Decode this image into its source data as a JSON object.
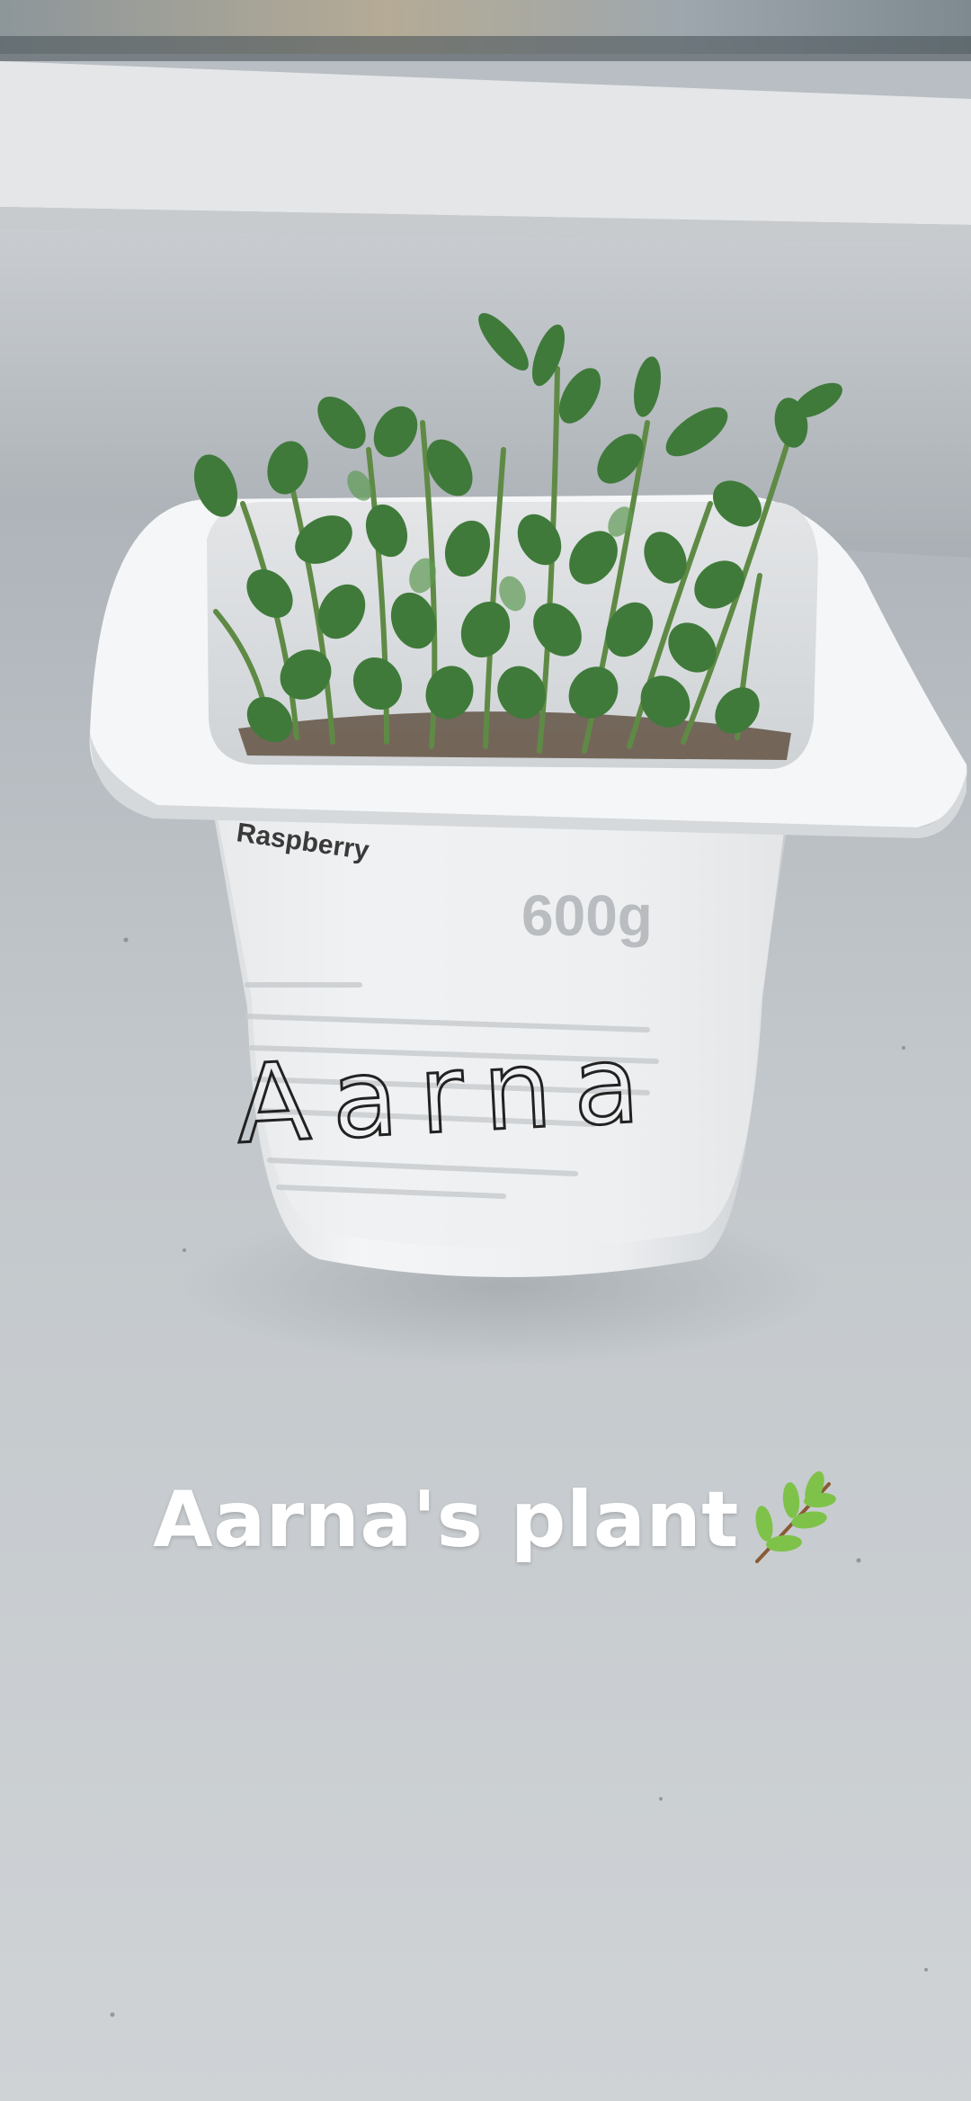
{
  "caption": {
    "text": "Aarna's plant",
    "emoji_icon": "herb-icon"
  },
  "pot_label": {
    "product_name": "Raspberry",
    "weight": "600g",
    "handwritten_name": "Aarna"
  },
  "colors": {
    "windowsill": "#c3c8cc",
    "window_frame": "#e6e8ea",
    "pot_white": "#f2f3f4",
    "leaf_green": "#3f7a3a",
    "caption_text": "#ffffff"
  }
}
